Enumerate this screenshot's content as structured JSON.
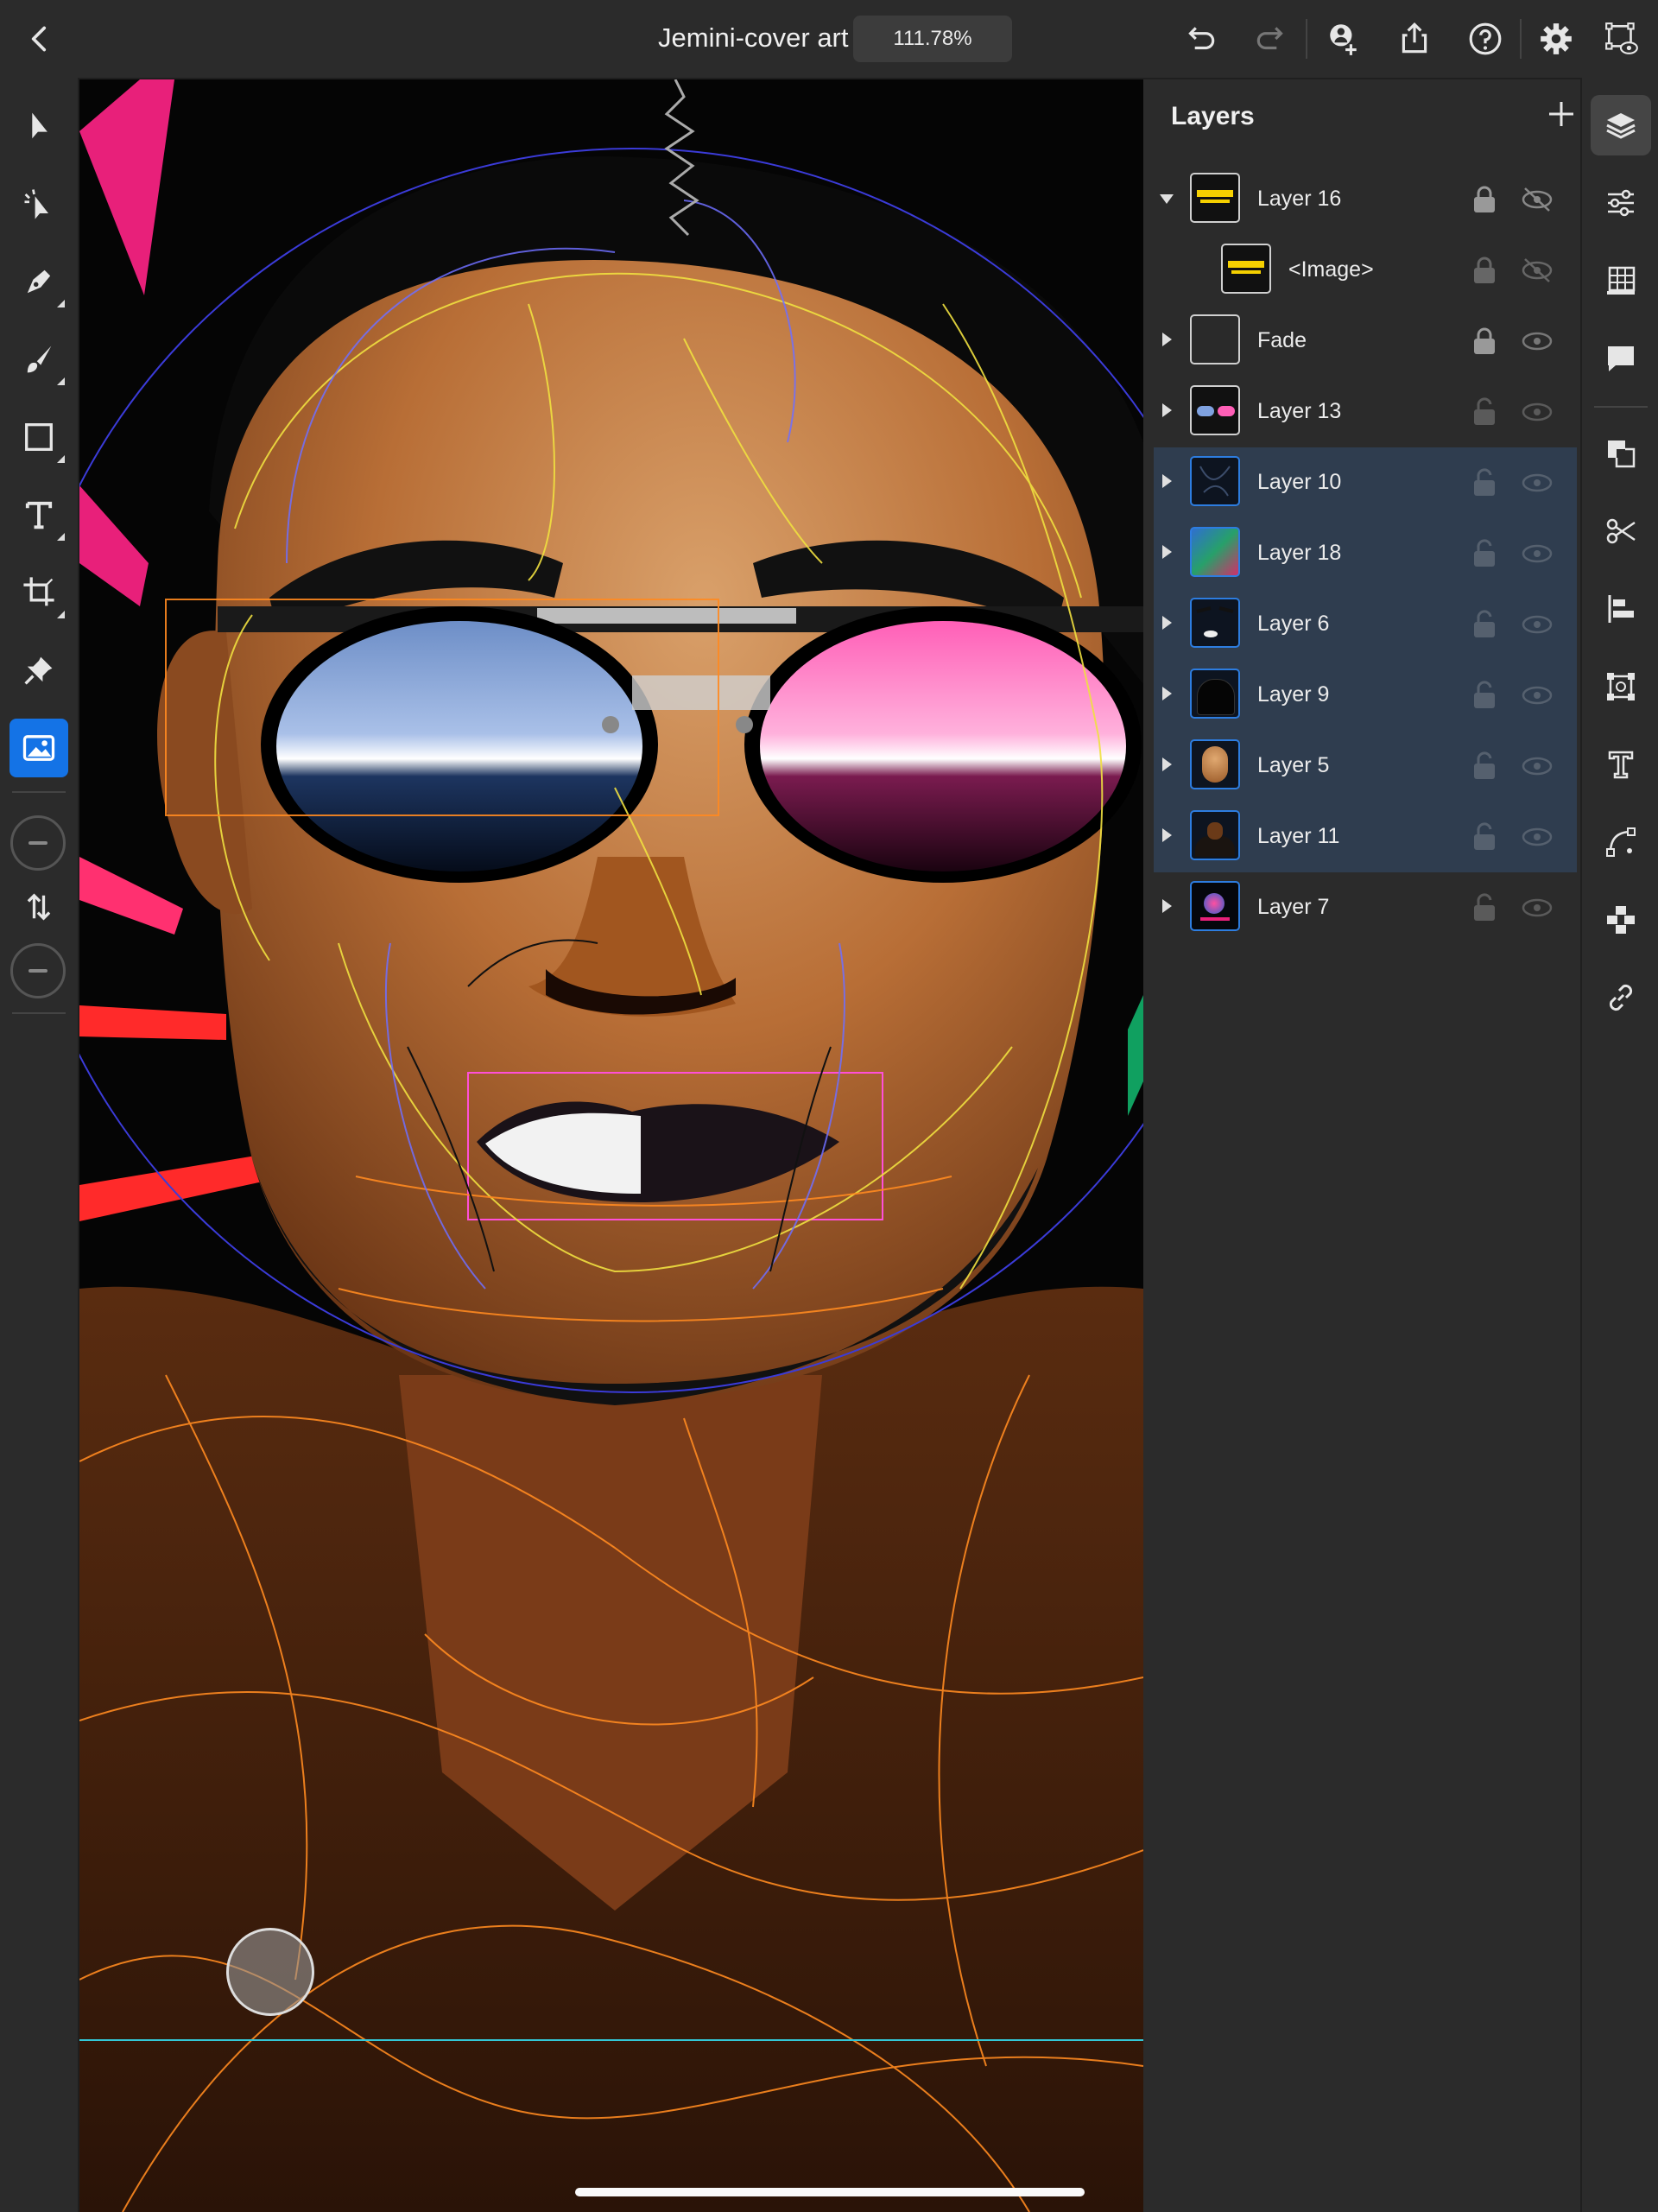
{
  "header": {
    "document_title": "Jemini-cover art",
    "zoom": "111.78%",
    "icons": [
      "back-chevron-icon",
      "undo-icon",
      "redo-icon",
      "invite-user-icon",
      "share-icon",
      "help-icon",
      "settings-icon",
      "preview-icon"
    ]
  },
  "left_tools": [
    "selection-icon",
    "direct-selection-icon",
    "pen-icon",
    "paintbrush-icon",
    "rectangle-icon",
    "type-icon",
    "crop-icon",
    "pin-icon",
    "image-icon",
    "stroke-swatch",
    "swap-icon",
    "fill-swatch"
  ],
  "layers_panel": {
    "title": "Layers",
    "layers": [
      {
        "name": "Layer 16",
        "expanded": true,
        "locked": true,
        "visible": false,
        "selected": false
      },
      {
        "name": "<Image>",
        "child": true,
        "locked": true,
        "visible": false,
        "selected": false
      },
      {
        "name": "Fade",
        "locked": true,
        "visible": true,
        "selected": false
      },
      {
        "name": "Layer 13",
        "locked": false,
        "visible": true,
        "selected": false
      },
      {
        "name": "Layer 10",
        "locked": false,
        "visible": true,
        "selected": true
      },
      {
        "name": "Layer 18",
        "locked": false,
        "visible": true,
        "selected": true
      },
      {
        "name": "Layer 6",
        "locked": false,
        "visible": true,
        "selected": true
      },
      {
        "name": "Layer 9",
        "locked": false,
        "visible": true,
        "selected": true
      },
      {
        "name": "Layer 5",
        "locked": false,
        "visible": true,
        "selected": true
      },
      {
        "name": "Layer 11",
        "locked": false,
        "visible": true,
        "selected": true
      },
      {
        "name": "Layer 7",
        "locked": false,
        "visible": true,
        "selected": false
      }
    ]
  },
  "right_tools": [
    "layers-icon",
    "properties-icon",
    "grid-icon",
    "comments-icon",
    "combine-shapes-icon",
    "cut-icon",
    "align-icon",
    "transform-icon",
    "type-properties-icon",
    "path-icon",
    "repeat-icon",
    "link-icon"
  ],
  "colors": {
    "accent": "#1473e6",
    "selection": "#2f3d4f",
    "panel": "#2b2b2b"
  }
}
